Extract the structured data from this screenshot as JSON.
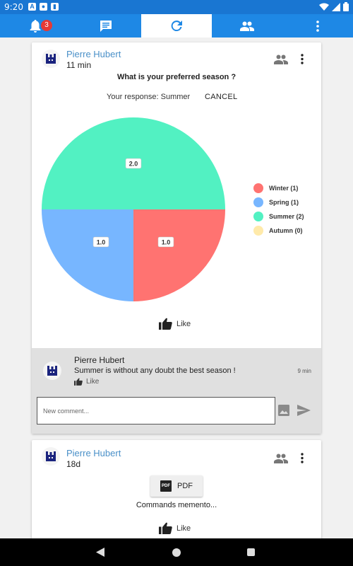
{
  "status_bar": {
    "time": "9:20"
  },
  "tabs": {
    "notification_count": "3",
    "items": [
      {
        "name": "notifications",
        "icon": "bell-icon"
      },
      {
        "name": "messages",
        "icon": "chat-icon"
      },
      {
        "name": "refresh",
        "icon": "refresh-icon",
        "active": true
      },
      {
        "name": "groups",
        "icon": "group-icon"
      },
      {
        "name": "more",
        "icon": "more-vert-icon"
      }
    ]
  },
  "post1": {
    "author": "Pierre Hubert",
    "time": "11 min",
    "question": "What is your preferred season ?",
    "response": "Your response: Summer",
    "cancel": "CANCEL",
    "like": "Like",
    "comment": {
      "author": "Pierre Hubert",
      "text": "Summer is without any doubt the best season !",
      "time": "9 min",
      "like": "Like"
    },
    "new_comment_placeholder": "New comment..."
  },
  "chart_data": {
    "type": "pie",
    "categories": [
      "Winter",
      "Spring",
      "Summer",
      "Autumn"
    ],
    "values": [
      1.0,
      1.0,
      2.0,
      0
    ],
    "legend": [
      "Winter (1)",
      "Spring (1)",
      "Summer (2)",
      "Autumn (0)"
    ],
    "data_labels": [
      "1.0",
      "1.0",
      "2.0",
      ""
    ],
    "colors": [
      "#ff7371",
      "#77b6ff",
      "#52f1c2",
      "#ffeaaa"
    ],
    "legend_position": "right"
  },
  "post2": {
    "author": "Pierre Hubert",
    "time": "18d",
    "pdf_label": "PDF",
    "file_name": "Commands memento...",
    "like": "Like"
  },
  "colors": {
    "primary": "#1e88e5",
    "author": "#4a90c8"
  }
}
